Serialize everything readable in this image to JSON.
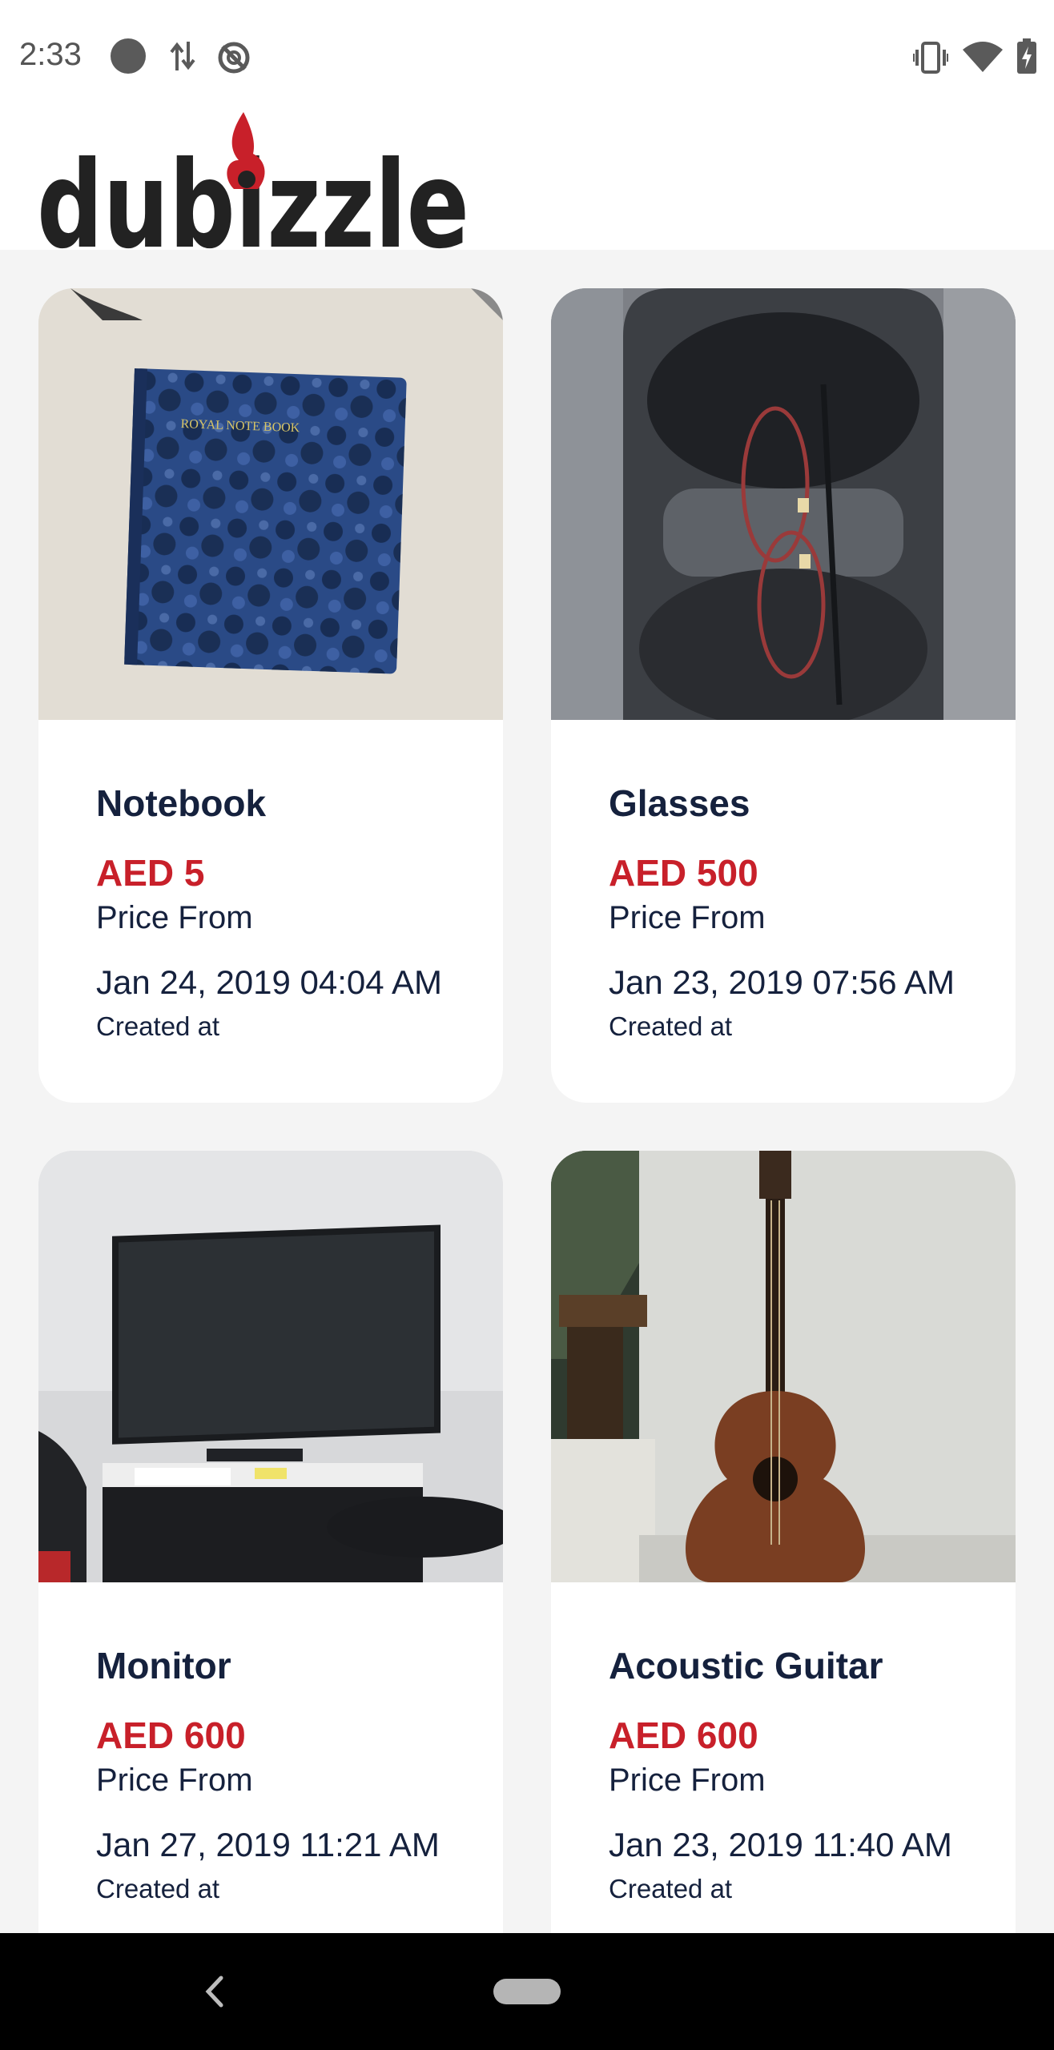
{
  "status_bar": {
    "time": "2:33",
    "icons": [
      "notification-dot-icon",
      "data-arrows-icon",
      "sync-off-icon",
      "vibrate-icon",
      "wifi-icon",
      "battery-charging-icon"
    ]
  },
  "header": {
    "logo_text": "dubizzle",
    "logo_icon": "torch-flame-icon",
    "colors": {
      "logo_text": "#222222",
      "flame": "#c8202a"
    }
  },
  "listings": [
    {
      "title": "Notebook",
      "price": "AED 5",
      "price_label": "Price From",
      "date": "Jan 24, 2019 04:04 AM",
      "date_label": "Created at",
      "image": "blue marbled notebook on table",
      "image_text": "ROYAL NOTE BOOK"
    },
    {
      "title": "Glasses",
      "price": "AED 500",
      "price_label": "Price From",
      "date": "Jan 23, 2019 07:56 AM",
      "date_label": "Created at",
      "image": "glasses in car cup holder"
    },
    {
      "title": "Monitor",
      "price": "AED 600",
      "price_label": "Price From",
      "date": "Jan 27, 2019 11:21 AM",
      "date_label": "Created at",
      "image": "wall-mounted TV monitor in room"
    },
    {
      "title": "Acoustic Guitar",
      "price": "AED 600",
      "price_label": "Price From",
      "date": "Jan 23, 2019 11:40 AM",
      "date_label": "Created at",
      "image": "acoustic guitar leaning on wall"
    }
  ],
  "colors": {
    "title": "#15213d",
    "price": "#c8202a",
    "background": "#f4f4f4",
    "card": "#ffffff"
  },
  "nav_bar": {
    "back_icon": "back-chevron-icon",
    "home_icon": "home-pill-icon"
  }
}
